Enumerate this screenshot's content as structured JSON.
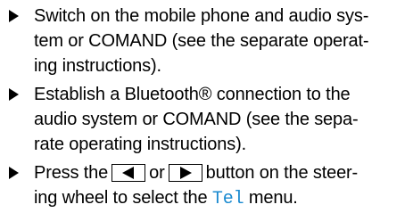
{
  "colors": {
    "text": "#000000",
    "menu_highlight": "#1a8ad0"
  },
  "steps": [
    {
      "lines": [
        "Switch on the mobile phone and audio sys-",
        "tem or COMAND (see the separate operat-",
        "ing instructions)."
      ]
    },
    {
      "lines": [
        "Establish a Bluetooth® connection to the",
        "audio system or COMAND (see the sepa-",
        "rate operating instructions)."
      ]
    },
    {
      "line1_before_keys": "Press the",
      "key_left_icon": "left-triangle-icon",
      "or_text": "or",
      "key_right_icon": "right-triangle-icon",
      "line1_after_keys": "button on the steer-",
      "line2_before_menu": "ing wheel to select the",
      "menu_name": "Tel",
      "line2_after_menu": "menu."
    }
  ]
}
